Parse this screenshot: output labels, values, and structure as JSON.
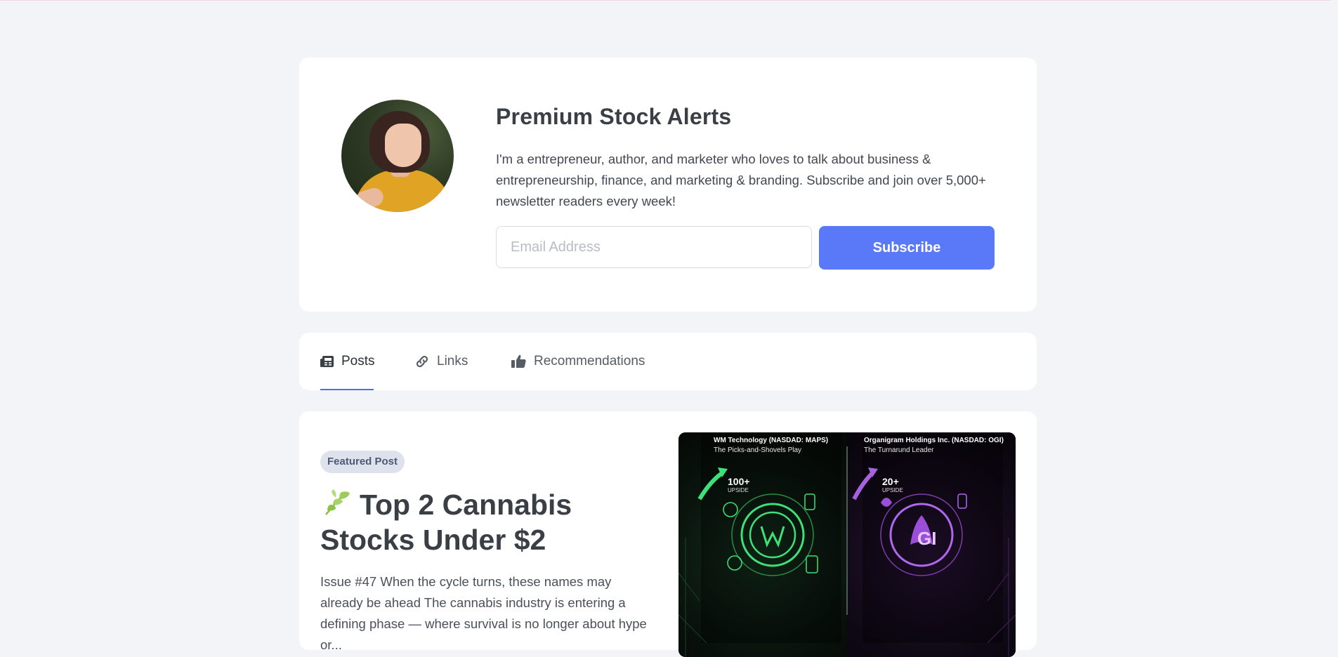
{
  "profile": {
    "title": "Premium Stock Alerts",
    "description": "I'm a entrepreneur, author, and marketer who loves to talk about business & entrepreneurship, finance, and marketing & branding. Subscribe and join over 5,000+ newsletter readers every week!",
    "email_placeholder": "Email Address",
    "subscribe_label": "Subscribe"
  },
  "tabs": [
    {
      "label": "Posts",
      "icon": "newspaper-icon",
      "active": true
    },
    {
      "label": "Links",
      "icon": "link-icon",
      "active": false
    },
    {
      "label": "Recommendations",
      "icon": "thumbs-up-icon",
      "active": false
    }
  ],
  "featured_post": {
    "badge": "Featured Post",
    "title": "Top 2 Cannabis Stocks Under $2",
    "title_icon": "leaf-icon",
    "excerpt": "Issue #47 When the cycle turns, these names may already be ahead The cannabis industry is entering a defining phase — where survival is no longer about hype or...",
    "image": {
      "left": {
        "ticker": "WM Technology (NASDAD: MAPS)",
        "tagline": "The Picks-and-Shovels Play",
        "stat": "100+",
        "stat_label": "UPSIDE"
      },
      "right": {
        "ticker": "Organigram Holdings Inc. (NASDAD: OGI)",
        "tagline": "The Turnarund Leader",
        "stat": "20+",
        "stat_label": "UPSIDE"
      }
    }
  },
  "colors": {
    "accent": "#5a79f9",
    "background": "#f2f4f7"
  }
}
